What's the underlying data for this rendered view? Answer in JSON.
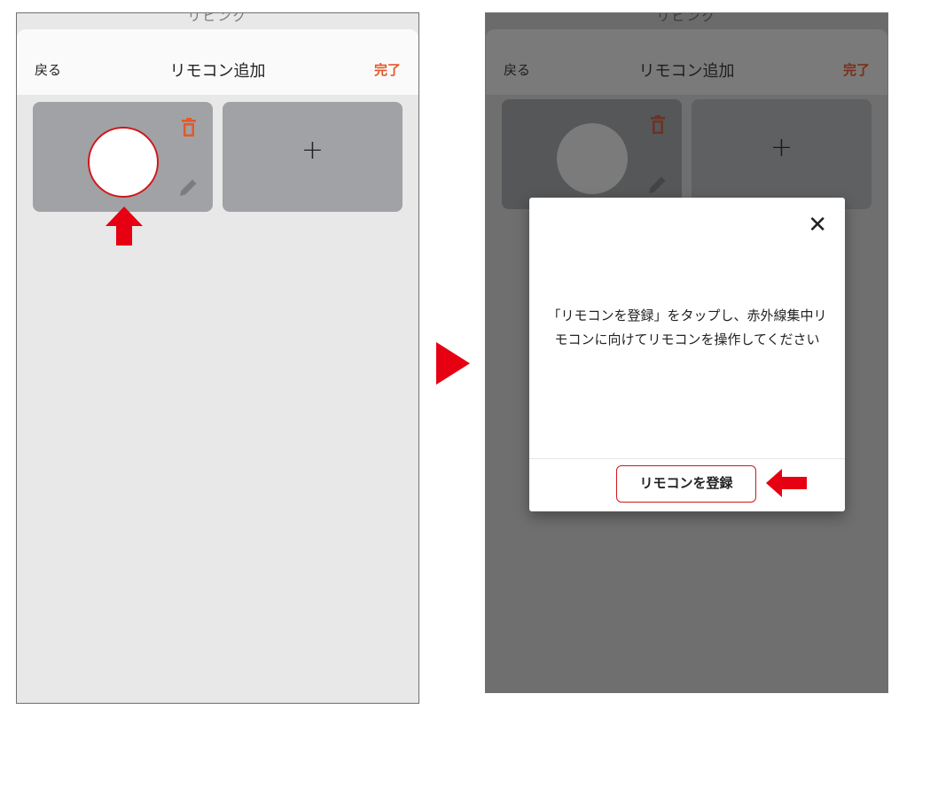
{
  "screens": [
    {
      "status_peek": "リビング",
      "header": {
        "back": "戻る",
        "title": "リモコン追加",
        "done": "完了"
      },
      "add_card_label": "+"
    },
    {
      "status_peek": "リビング",
      "header": {
        "back": "戻る",
        "title": "リモコン追加",
        "done": "完了"
      },
      "add_card_label": "+",
      "modal": {
        "close": "✕",
        "message_line1": "「リモコンを登録」をタップし、赤外線集中リ",
        "message_line2": "モコンに向けてリモコンを操作してください",
        "register_button": "リモコンを登録"
      }
    }
  ],
  "colors": {
    "accent": "#e4582b",
    "callout_red": "#d0171b",
    "arrow_red": "#e60012"
  },
  "icons": [
    "trash-icon",
    "pencil-icon",
    "plus-icon",
    "close-icon"
  ]
}
